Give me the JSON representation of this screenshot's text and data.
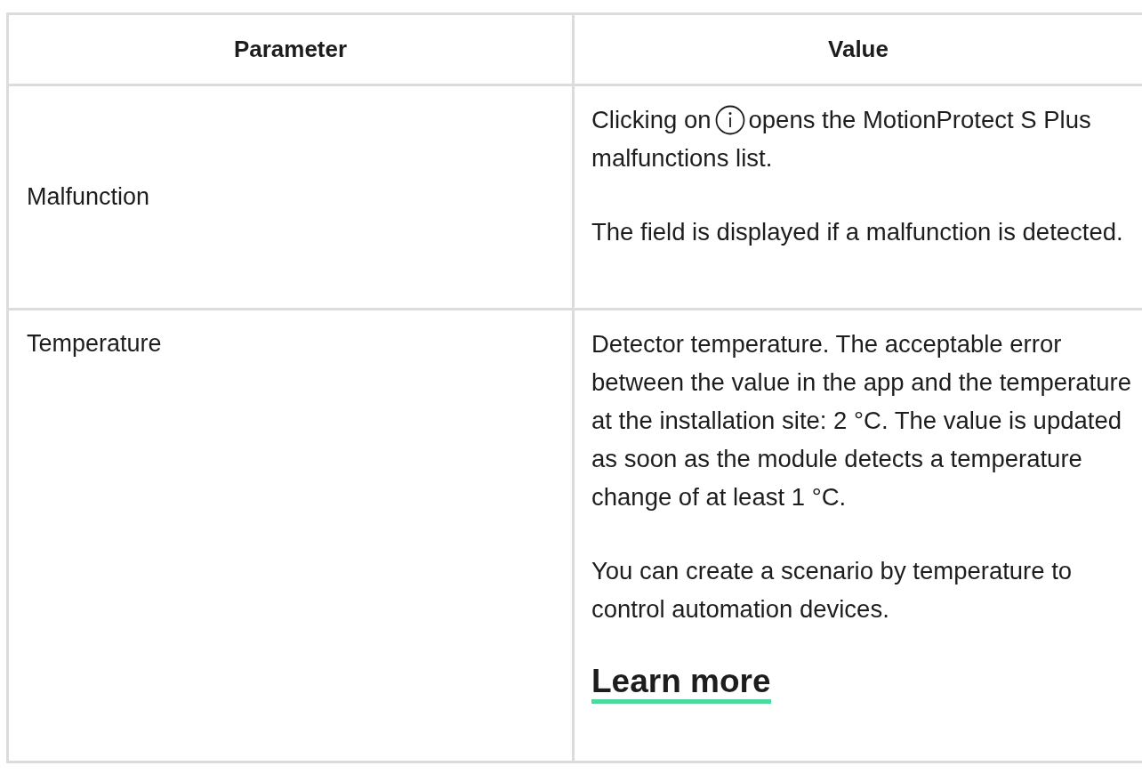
{
  "table": {
    "columns": [
      "Parameter",
      "Value"
    ],
    "rows": [
      {
        "parameter": "Malfunction",
        "value": [
          {
            "kind": "icon_text",
            "before": "Clicking on",
            "after": "opens the MotionProtect S Plus",
            "continuation": "malfunctions list."
          },
          {
            "kind": "text",
            "text": "The field is displayed if a malfunction is detected."
          }
        ]
      },
      {
        "parameter": "Temperature",
        "value": [
          {
            "kind": "text",
            "text": "Detector temperature. The acceptable error between the value in the app and the temperature at the installation site: 2 °C. The value is updated as soon as the module detects a temperature change of at least 1 °C."
          },
          {
            "kind": "text",
            "text": "You can create a scenario by temperature to control automation devices."
          },
          {
            "kind": "link",
            "text": "Learn more"
          }
        ]
      }
    ]
  }
}
